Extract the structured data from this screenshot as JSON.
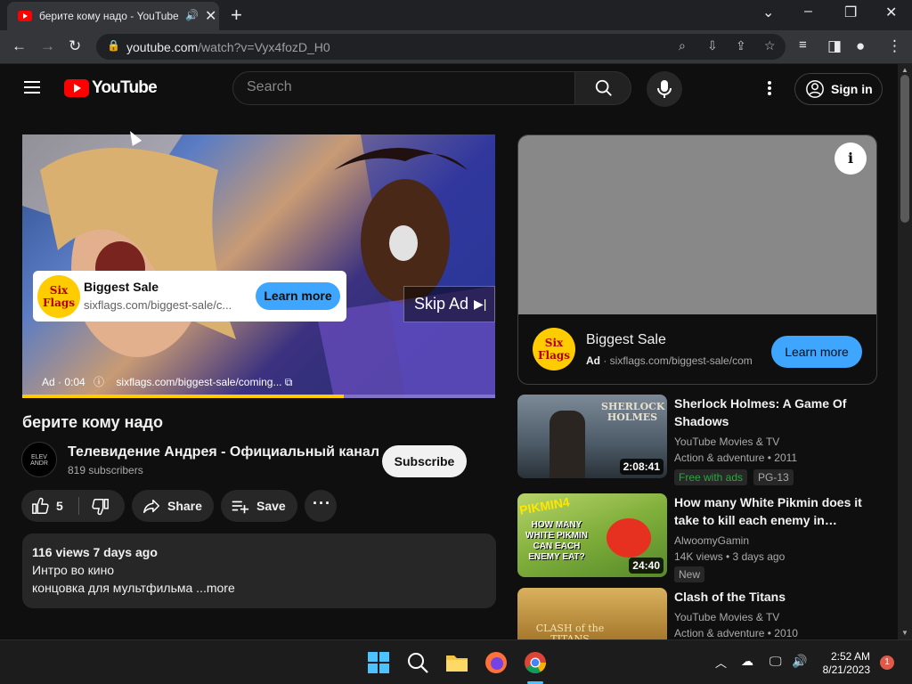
{
  "browser": {
    "tab_title": "берите кому надо - YouTube",
    "tab_audio_icon": "🔊",
    "url_host": "youtube.com",
    "url_path": "/watch?v=Vyx4fozD_H0"
  },
  "header": {
    "logo_text": "YouTube",
    "search_placeholder": "Search",
    "signin_label": "Sign in"
  },
  "player": {
    "ad_card": {
      "logo_text": "Six Flags",
      "title": "Biggest Sale",
      "url": "sixflags.com/biggest-sale/c...",
      "cta": "Learn more"
    },
    "skip_label": "Skip Ad",
    "ad_label": "Ad · 0:04",
    "ad_url": "sixflags.com/biggest-sale/coming...",
    "ad_progress": 0.68
  },
  "video": {
    "title": "берите кому надо",
    "channel_name": "Телевидение Андрея - Официальный канал",
    "channel_avatar_text": "ELEV ANDR",
    "subscribers": "819 subscribers",
    "subscribe_label": "Subscribe",
    "likes": "5",
    "share_label": "Share",
    "save_label": "Save",
    "description": {
      "stats": "116 views  7 days ago",
      "line1": "Интро во кино",
      "line2": "концовка для мультфильма ...more"
    }
  },
  "sidebar_ad": {
    "logo_text": "Six Flags",
    "title": "Biggest Sale",
    "ad_tag": "Ad",
    "url": "sixflags.com/biggest-sale/com",
    "cta": "Learn more"
  },
  "recommendations": [
    {
      "title": "Sherlock Holmes: A Game Of Shadows",
      "thumb_text": "SHERLOCK HOLMES",
      "duration": "2:08:41",
      "channel": "YouTube Movies & TV",
      "meta": "Action & adventure • 2011",
      "badges": [
        "Free with ads",
        "PG-13"
      ]
    },
    {
      "title": "How many White Pikmin does it take to kill each enemy in…",
      "thumb_text": "HOW MANY WHITE PIKMIN CAN EACH ENEMY EAT?",
      "thumb_tag": "PIKMIN4",
      "duration": "24:40",
      "channel": "AlwoomyGamin",
      "meta": "14K views  • 3 days ago",
      "badges": [
        "New"
      ]
    },
    {
      "title": "Clash of the Titans",
      "thumb_text": "CLASH of the TITANS",
      "channel": "YouTube Movies & TV",
      "meta": "Action & adventure • 2010"
    }
  ],
  "taskbar": {
    "time": "2:52 AM",
    "date": "8/21/2023",
    "notification_count": "1"
  },
  "colors": {
    "yt_red": "#ff0000",
    "accent_blue": "#3ea6ff",
    "ad_yellow": "#ffcc00",
    "badge_green": "#2ba640"
  }
}
